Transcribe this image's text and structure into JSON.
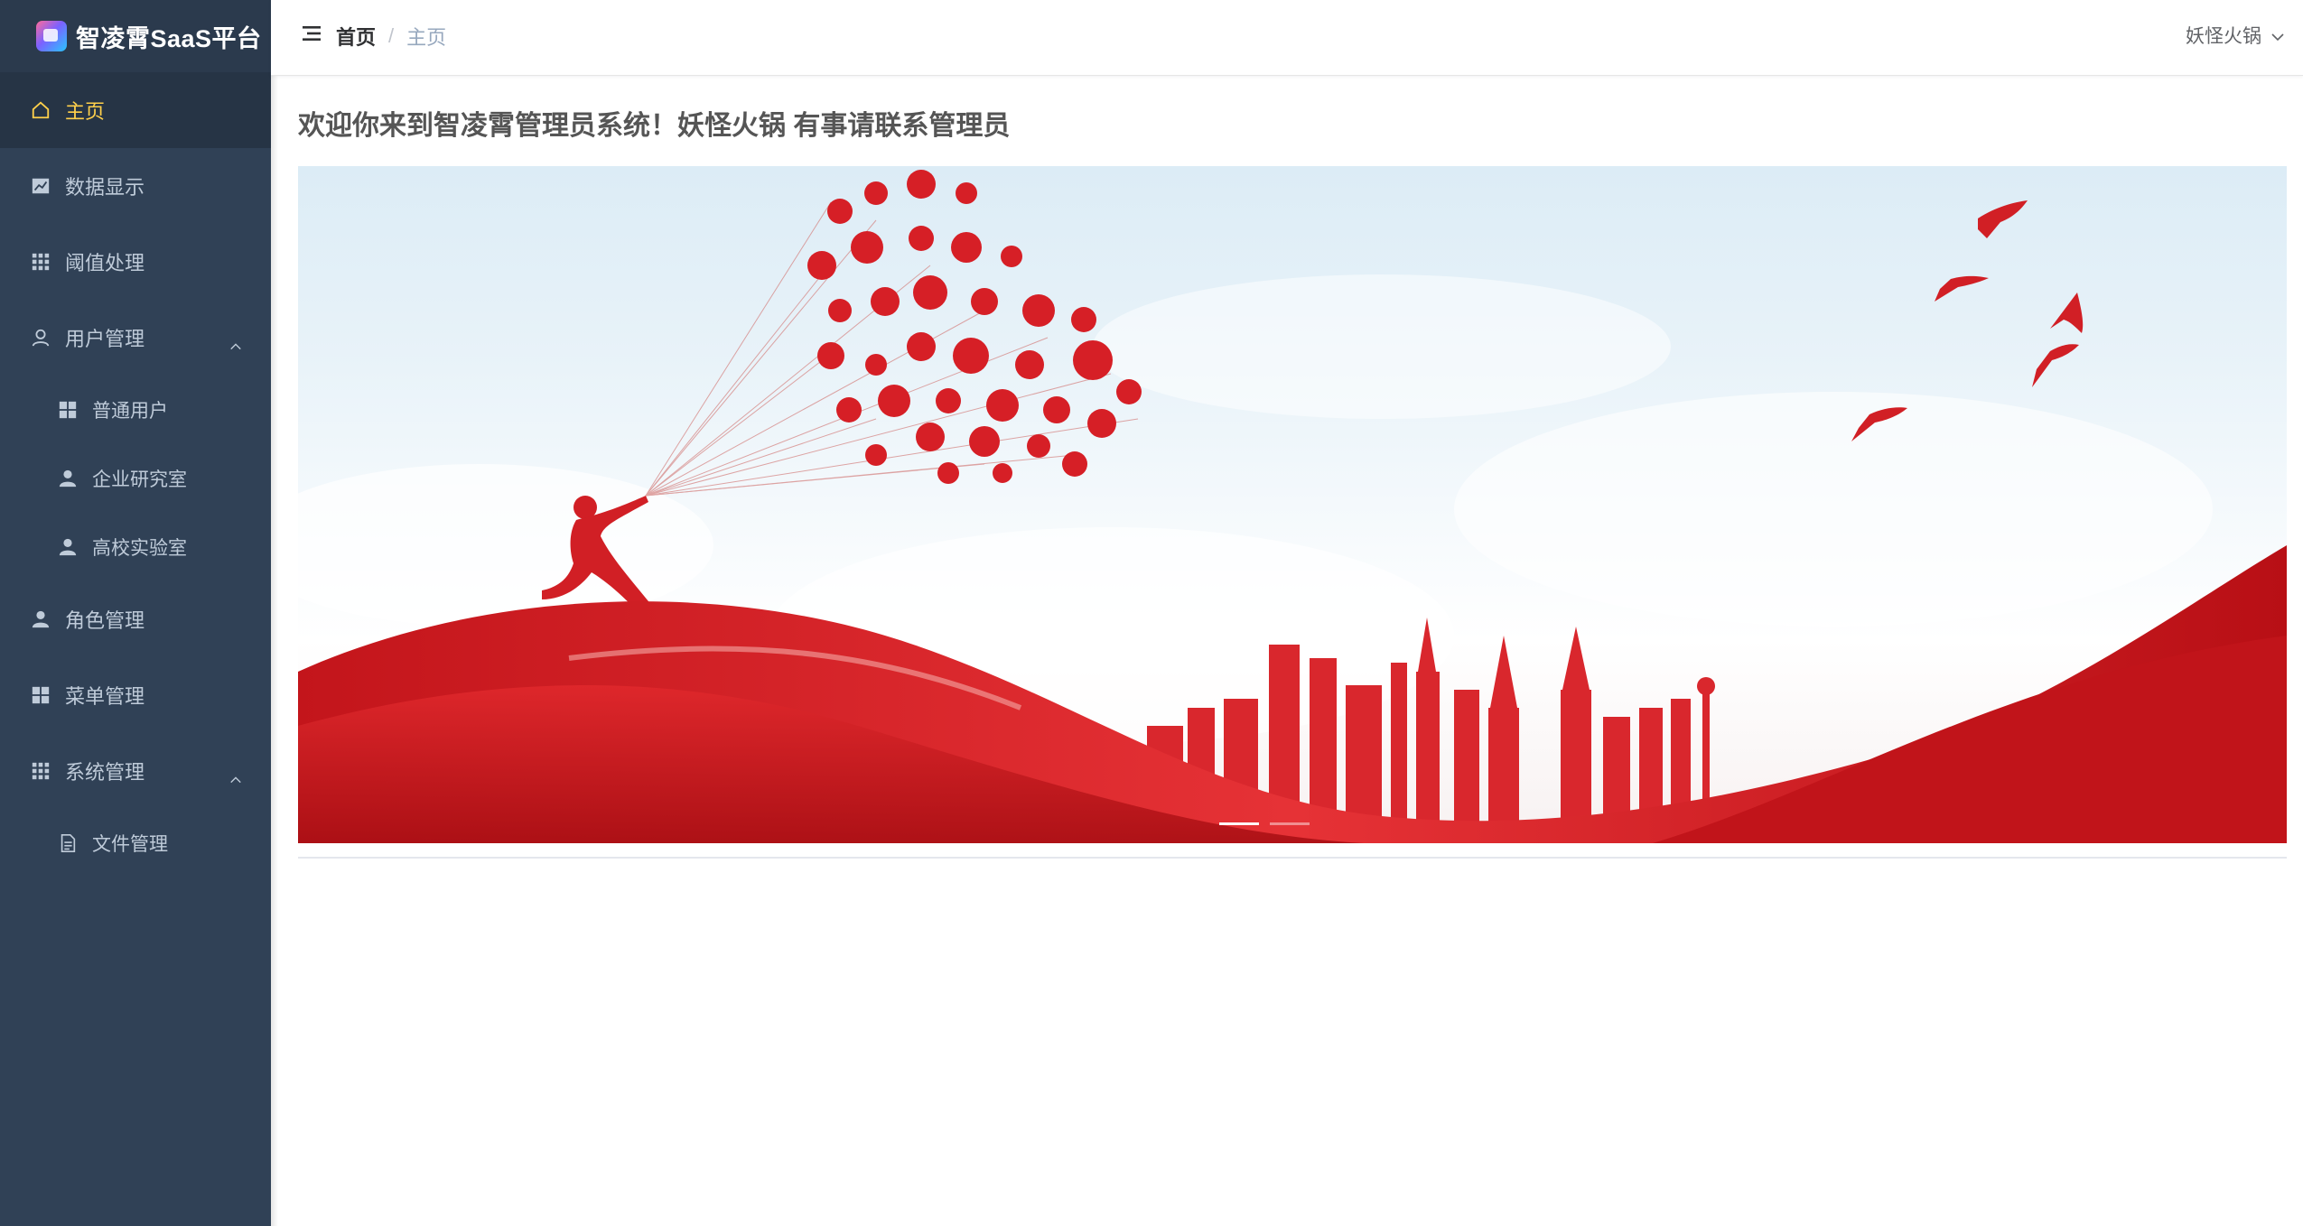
{
  "app": {
    "title": "智凌霄SaaS平台"
  },
  "sidebar": {
    "items": [
      {
        "label": "主页",
        "icon": "home-icon",
        "active": true
      },
      {
        "label": "数据显示",
        "icon": "chart-icon"
      },
      {
        "label": "阈值处理",
        "icon": "grid-icon"
      },
      {
        "label": "用户管理",
        "icon": "user-outline-icon",
        "expanded": true,
        "children": [
          {
            "label": "普通用户",
            "icon": "grid4-icon"
          },
          {
            "label": "企业研究室",
            "icon": "person-icon"
          },
          {
            "label": "高校实验室",
            "icon": "person-icon"
          }
        ]
      },
      {
        "label": "角色管理",
        "icon": "person-icon"
      },
      {
        "label": "菜单管理",
        "icon": "grid4-icon"
      },
      {
        "label": "系统管理",
        "icon": "grid-icon",
        "expanded": true,
        "children": [
          {
            "label": "文件管理",
            "icon": "document-icon"
          }
        ]
      }
    ],
    "active_color": "#ffd04b",
    "background": "#304156"
  },
  "header": {
    "breadcrumb": {
      "home": "首页",
      "separator": "/",
      "current": "主页"
    },
    "user": "妖怪火锅"
  },
  "main": {
    "welcome": "欢迎你来到智凌霄管理员系统！妖怪火锅 有事请联系管理员",
    "carousel": {
      "indicator_count": 2,
      "active_indicator": 0
    }
  }
}
